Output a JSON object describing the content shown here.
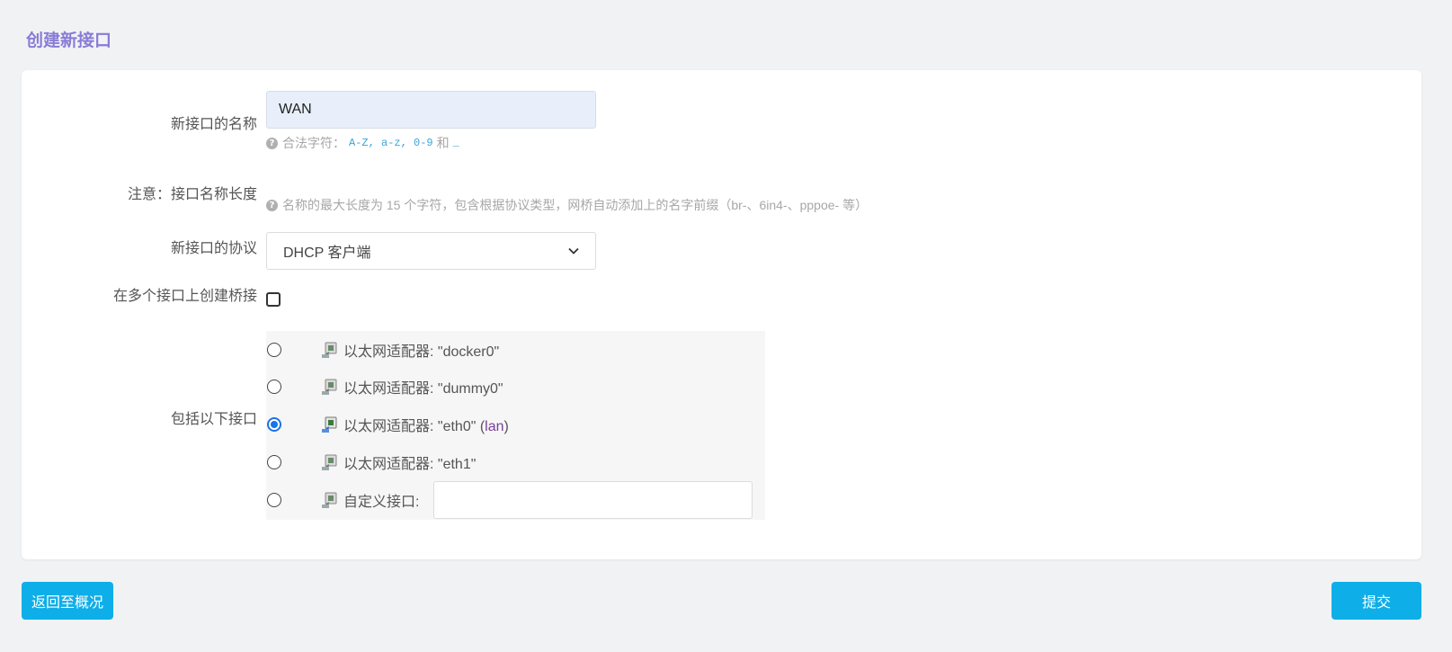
{
  "page": {
    "title": "创建新接口"
  },
  "form": {
    "name": {
      "label": "新接口的名称",
      "value": "WAN",
      "hint_prefix": "合法字符：",
      "hint_chars": "A-Z, a-z, 0-9",
      "hint_and": "和",
      "hint_underscore": "_"
    },
    "note": {
      "label": "注意：接口名称长度",
      "hint": "名称的最大长度为 15 个字符，包含根据协议类型，网桥自动添加上的名字前缀（br-、6in4-、pppoe- 等）"
    },
    "protocol": {
      "label": "新接口的协议",
      "selected": "DHCP 客户端"
    },
    "bridge": {
      "label": "在多个接口上创建桥接",
      "checked": false
    },
    "interfaces": {
      "label": "包括以下接口",
      "items": [
        {
          "text": "以太网适配器: \"docker0\"",
          "checked": false
        },
        {
          "text": "以太网适配器: \"dummy0\"",
          "checked": false
        },
        {
          "text": "以太网适配器: \"eth0\" (",
          "zone": "lan",
          "suffix": ")",
          "checked": true
        },
        {
          "text": "以太网适配器: \"eth1\"",
          "checked": false
        }
      ],
      "custom_label": "自定义接口:",
      "custom_value": ""
    }
  },
  "actions": {
    "back_label": "返回至概况",
    "submit_label": "提交"
  },
  "colors": {
    "accent": "#0eaee8",
    "title": "#8a7bd6",
    "zone_lan": "#7a3f9d",
    "radio_checked": "#1a73e8"
  },
  "icons": {
    "hint": "help-circle-icon",
    "adapter": "ethernet-adapter-icon",
    "select": "chevron-down-icon"
  }
}
